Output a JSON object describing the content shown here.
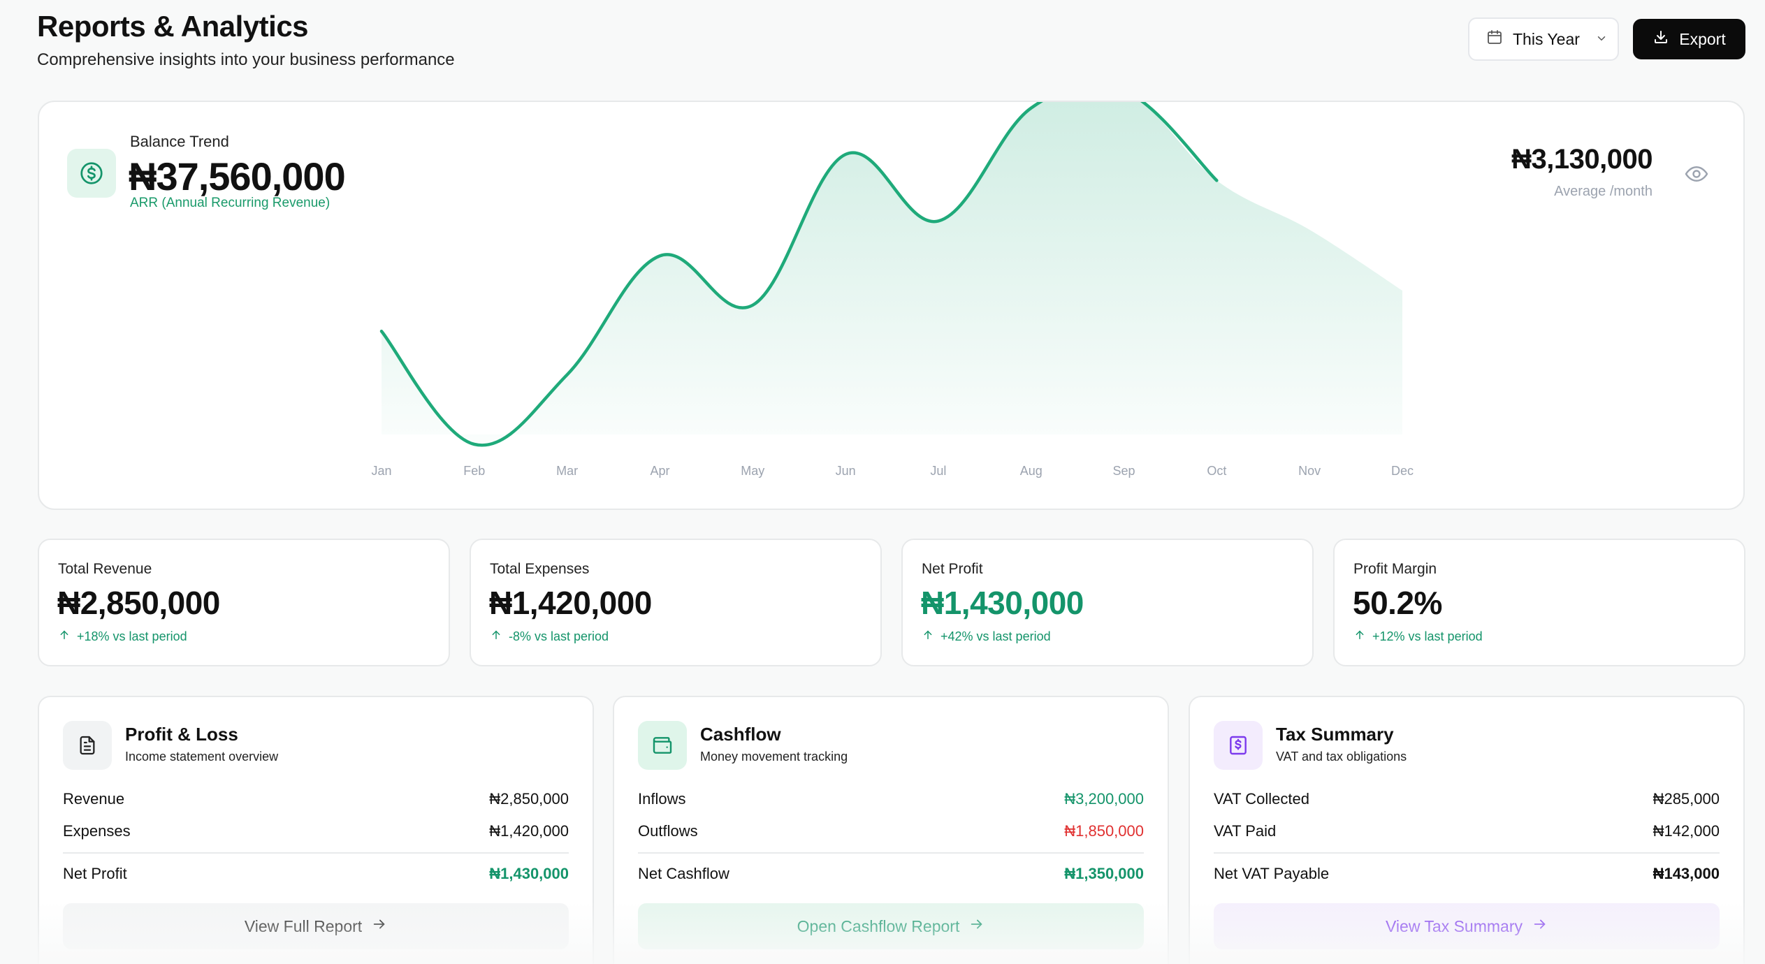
{
  "header": {
    "title": "Reports & Analytics",
    "subtitle": "Comprehensive insights into your business performance",
    "period": "This Year",
    "export_label": "Export"
  },
  "balance_trend": {
    "label": "Balance Trend",
    "value": "₦37,560,000",
    "sub_label": "ARR (Annual Recurring Revenue)",
    "average_value": "₦3,130,000",
    "average_label": "Average /month",
    "icon": "dollar-circle-icon"
  },
  "chart_data": {
    "type": "line",
    "categories": [
      "Jan",
      "Feb",
      "Mar",
      "Apr",
      "May",
      "Jun",
      "Jul",
      "Aug",
      "Sep",
      "Oct",
      "Nov",
      "Dec"
    ],
    "series": [
      {
        "values": [
          0.39,
          0.0,
          0.24,
          0.65,
          0.48,
          1.0,
          0.77,
          1.16,
          1.22,
          0.91,
          0.74,
          0.53
        ]
      }
    ],
    "actual_through": "Oct",
    "ylabel": "",
    "grid": false,
    "colors": {
      "line": "#1faa7a",
      "area": "#1faa7a"
    }
  },
  "stats": [
    {
      "label": "Total Revenue",
      "value": "₦2,850,000",
      "change": "+18% vs last period"
    },
    {
      "label": "Total Expenses",
      "value": "₦1,420,000",
      "change": "-8% vs last period"
    },
    {
      "label": "Net Profit",
      "value": "₦1,430,000",
      "change": "+42% vs last period"
    },
    {
      "label": "Profit Margin",
      "value": "50.2%",
      "change": "+12% vs last period"
    }
  ],
  "profit_loss": {
    "title": "Profit & Loss",
    "subtitle": "Income statement overview",
    "rows": [
      {
        "label": "Revenue",
        "value": "₦2,850,000"
      },
      {
        "label": "Expenses",
        "value": "₦1,420,000"
      }
    ],
    "total_label": "Net Profit",
    "total_value": "₦1,430,000",
    "button": "View Full Report"
  },
  "cashflow": {
    "title": "Cashflow",
    "subtitle": "Money movement tracking",
    "rows": [
      {
        "label": "Inflows",
        "value": "₦3,200,000"
      },
      {
        "label": "Outflows",
        "value": "₦1,850,000"
      }
    ],
    "total_label": "Net Cashflow",
    "total_value": "₦1,350,000",
    "button": "Open Cashflow Report"
  },
  "tax_summary": {
    "title": "Tax Summary",
    "subtitle": "VAT and tax obligations",
    "rows": [
      {
        "label": "VAT Collected",
        "value": "₦285,000"
      },
      {
        "label": "VAT Paid",
        "value": "₦142,000"
      }
    ],
    "total_label": "Net VAT Payable",
    "total_value": "₦143,000",
    "button": "View Tax Summary"
  },
  "colors": {
    "accent_green": "#14946a",
    "negative_red": "#e03131",
    "purple": "#7c3aed"
  }
}
